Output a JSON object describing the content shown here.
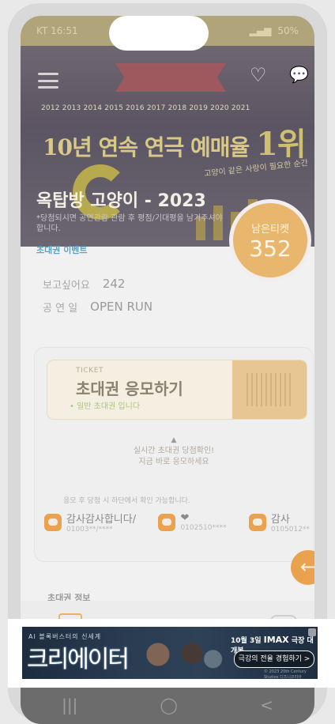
{
  "status_bar": {
    "carrier_time": "KT 16:51",
    "right": "50%"
  },
  "hero": {
    "years": "2012 2013 2014 2015 2016 2017 2018 2019 2020 2021",
    "headline": "10년 연속 연극 예매율",
    "rank": "1위",
    "tagline": "고양이 같은 사랑이 필요한 순간",
    "show_title": "옥탑방 고양이 - 2023",
    "description": "*당첨되시면 공연관람 관람 후 평점/기대평을 남겨주셔야 합니다.",
    "event_link": "초대권 이벤트"
  },
  "badge": {
    "label": "남은티켓",
    "count": "352"
  },
  "info": {
    "rows": [
      {
        "key": "보고싶어요",
        "value": "242"
      },
      {
        "key": "공 연 일",
        "value": "OPEN RUN"
      }
    ]
  },
  "ticket": {
    "small": "TICKET",
    "title": "초대권 응모하기",
    "subtitle": "• 일반 초대권 입니다"
  },
  "live": {
    "line1": "실시간 초대권 당첨확인!",
    "line2": "지금 바로 응모하세요"
  },
  "note": "응모 후 당첨 시 하단에서 확인 가능합니다.",
  "winners": [
    {
      "name": "감사감사합니다/",
      "phone": "01003**/****"
    },
    {
      "name": "❤",
      "phone": "0102510****"
    },
    {
      "name": "감사",
      "phone": "0105012**"
    }
  ],
  "fab": {
    "icon": "←"
  },
  "section_title": "초대권 정보",
  "ad": {
    "kicker": "AI 블록버스터의 신세계",
    "logo": "크리에이터",
    "date_prefix": "10월 3일 ",
    "date_bold": "IMAX",
    "date_suffix": " 극장 대개봉",
    "cta": "극강의 전율 경험하기 >",
    "fine": "© 2023 20th Century Studios  디즈니코리아"
  },
  "navbar": {
    "recents": "|||",
    "home": "◯",
    "back": "<"
  }
}
